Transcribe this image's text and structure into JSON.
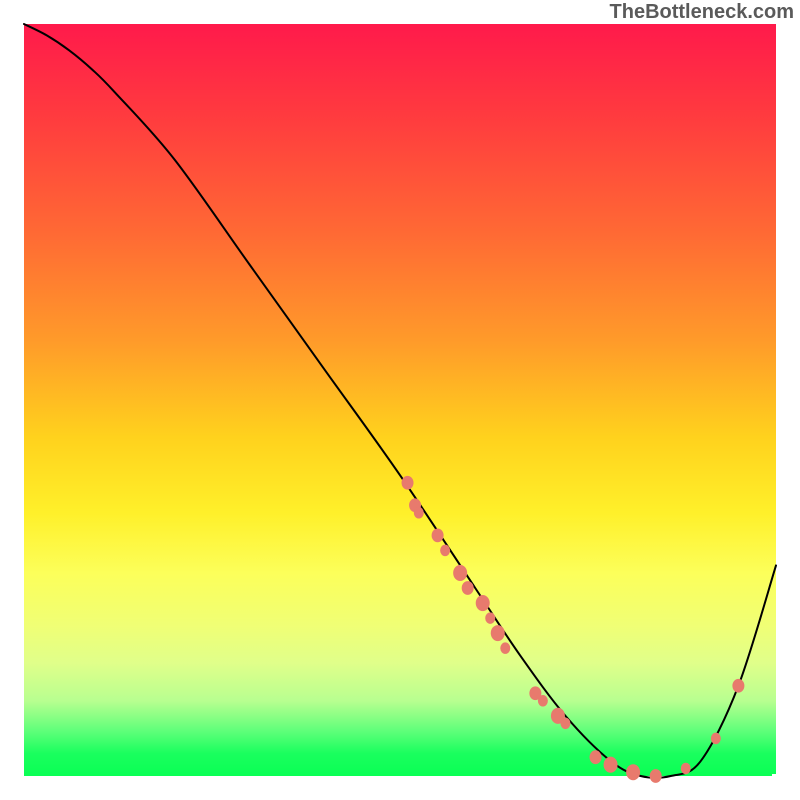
{
  "attribution": "TheBottleneck.com",
  "chart_data": {
    "type": "line",
    "title": "",
    "xlabel": "",
    "ylabel": "",
    "xlim": [
      0,
      100
    ],
    "ylim": [
      0,
      100
    ],
    "grid": false,
    "legend": false,
    "background_gradient": {
      "top": "#ff1a4b",
      "bottom": "#0aff54",
      "note": "vertical; red→orange→yellow→green"
    },
    "series": [
      {
        "name": "bottleneck-curve",
        "x": [
          0,
          3,
          6,
          9,
          12,
          20,
          30,
          40,
          50,
          60,
          66,
          72,
          78,
          82,
          86,
          90,
          95,
          100
        ],
        "y": [
          100,
          98.5,
          96.5,
          94,
          91,
          82,
          68,
          54,
          40,
          25,
          16,
          8,
          2,
          0,
          0,
          2,
          12,
          28
        ]
      }
    ],
    "markers": [
      {
        "name": "cluster-upper",
        "approx_x": 51,
        "approx_y": 39,
        "r": 6
      },
      {
        "name": "cluster-upper",
        "approx_x": 52,
        "approx_y": 36,
        "r": 6
      },
      {
        "name": "cluster-upper",
        "approx_x": 52.5,
        "approx_y": 35,
        "r": 5
      },
      {
        "name": "cluster-mid",
        "approx_x": 55,
        "approx_y": 32,
        "r": 6
      },
      {
        "name": "cluster-mid",
        "approx_x": 56,
        "approx_y": 30,
        "r": 5
      },
      {
        "name": "cluster-mid",
        "approx_x": 58,
        "approx_y": 27,
        "r": 7
      },
      {
        "name": "cluster-mid",
        "approx_x": 59,
        "approx_y": 25,
        "r": 6
      },
      {
        "name": "cluster-mid",
        "approx_x": 61,
        "approx_y": 23,
        "r": 7
      },
      {
        "name": "cluster-mid",
        "approx_x": 62,
        "approx_y": 21,
        "r": 5
      },
      {
        "name": "cluster-mid",
        "approx_x": 63,
        "approx_y": 19,
        "r": 7
      },
      {
        "name": "cluster-mid",
        "approx_x": 64,
        "approx_y": 17,
        "r": 5
      },
      {
        "name": "cluster-lower",
        "approx_x": 68,
        "approx_y": 11,
        "r": 6
      },
      {
        "name": "cluster-lower",
        "approx_x": 69,
        "approx_y": 10,
        "r": 5
      },
      {
        "name": "cluster-lower",
        "approx_x": 71,
        "approx_y": 8,
        "r": 7
      },
      {
        "name": "cluster-lower",
        "approx_x": 72,
        "approx_y": 7,
        "r": 5
      },
      {
        "name": "cluster-valley",
        "approx_x": 76,
        "approx_y": 2.5,
        "r": 6
      },
      {
        "name": "cluster-valley",
        "approx_x": 78,
        "approx_y": 1.5,
        "r": 7
      },
      {
        "name": "cluster-valley",
        "approx_x": 81,
        "approx_y": 0.5,
        "r": 7
      },
      {
        "name": "cluster-valley",
        "approx_x": 84,
        "approx_y": 0,
        "r": 6
      },
      {
        "name": "cluster-valley",
        "approx_x": 88,
        "approx_y": 1,
        "r": 5
      },
      {
        "name": "cluster-rise",
        "approx_x": 92,
        "approx_y": 5,
        "r": 5
      },
      {
        "name": "cluster-rise",
        "approx_x": 95,
        "approx_y": 12,
        "r": 6
      }
    ],
    "valley_x_approx": 84
  }
}
